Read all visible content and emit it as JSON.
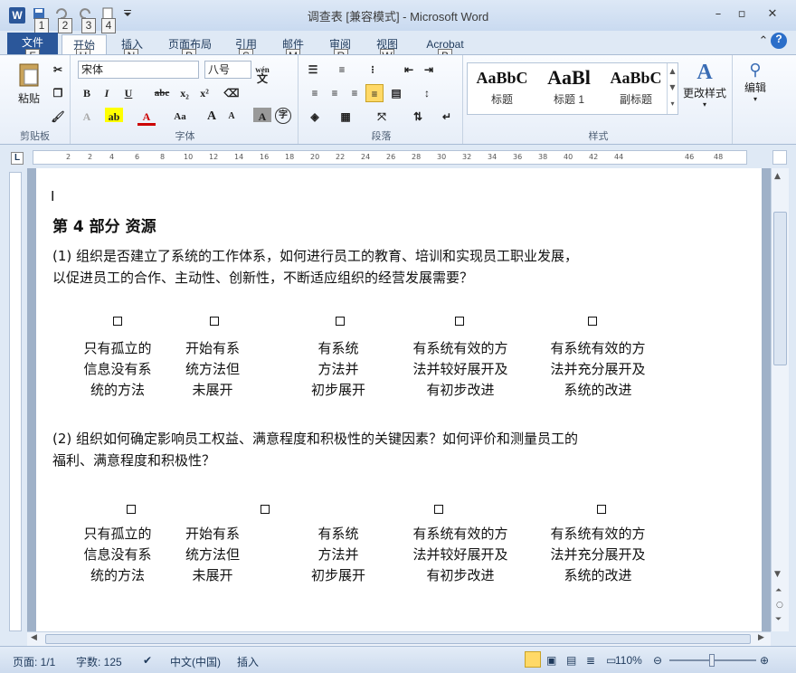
{
  "window": {
    "title": "调查表 [兼容模式] - Microsoft Word",
    "app_letter": "W"
  },
  "qat_keytips": [
    "1",
    "2",
    "3",
    "4"
  ],
  "tabs": [
    {
      "label": "文件",
      "keytip": "F"
    },
    {
      "label": "开始",
      "keytip": "H"
    },
    {
      "label": "插入",
      "keytip": "N"
    },
    {
      "label": "页面布局",
      "keytip": "P"
    },
    {
      "label": "引用",
      "keytip": "S"
    },
    {
      "label": "邮件",
      "keytip": "M"
    },
    {
      "label": "审阅",
      "keytip": "R"
    },
    {
      "label": "视图",
      "keytip": "W"
    },
    {
      "label": "Acrobat",
      "keytip": "B"
    }
  ],
  "ribbon": {
    "clipboard": {
      "label": "剪贴板",
      "paste": "粘贴"
    },
    "font": {
      "label": "字体",
      "font_name": "宋体",
      "font_size": "八号",
      "bold": "B",
      "italic": "I",
      "underline": "U",
      "strike": "abc",
      "sub": "x₂",
      "sup": "x²",
      "grow": "A",
      "shrink": "A",
      "case": "Aa",
      "wen": "文",
      "wen_top": "wén",
      "char_border": "A",
      "circle": "字"
    },
    "paragraph": {
      "label": "段落"
    },
    "styles": {
      "label": "样式",
      "items": [
        {
          "preview": "AaBbC",
          "name": "标题"
        },
        {
          "preview": "AaBl",
          "name": "标题 1"
        },
        {
          "preview": "AaBbC",
          "name": "副标题"
        }
      ],
      "change": "更改样式"
    },
    "editing": {
      "label": "编辑"
    }
  },
  "ruler": {
    "ticks": [
      "2",
      "2",
      "4",
      "6",
      "8",
      "10",
      "12",
      "14",
      "16",
      "18",
      "20",
      "22",
      "24",
      "26",
      "28",
      "30",
      "32",
      "34",
      "36",
      "38",
      "40",
      "42",
      "44",
      "46",
      "48"
    ]
  },
  "document": {
    "heading": "第 4  部分    资源",
    "q1": [
      "(1)  组织是否建立了系统的工作体系，如何进行员工的教育、培训和实现员工职业发展，",
      "以促进员工的合作、主动性、创新性，不断适应组织的经营发展需要？"
    ],
    "q2": [
      "(2)  组织如何确定影响员工权益、满意程度和积极性的关键因素？如何评价和测量员工的",
      "福利、满意程度和积极性？"
    ],
    "options": [
      [
        "只有孤立的",
        "信息没有系",
        "统的方法"
      ],
      [
        "开始有系",
        "统方法但",
        "未展开"
      ],
      [
        "有系统",
        "方法并",
        "初步展开"
      ],
      [
        "有系统有效的方",
        "法并较好展开及",
        "有初步改进"
      ],
      [
        "有系统有效的方",
        "法并充分展开及",
        "系统的改进"
      ]
    ]
  },
  "status": {
    "page": "页面: 1/1",
    "words": "字数: 125",
    "lang": "中文(中国)",
    "mode": "插入",
    "zoom": "110%"
  }
}
